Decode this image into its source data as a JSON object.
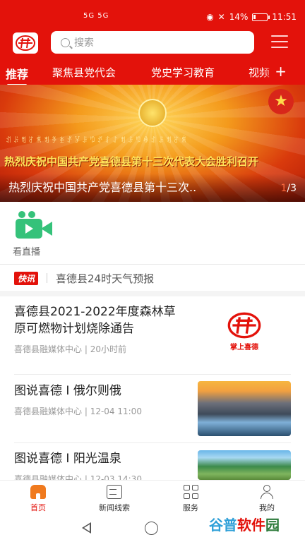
{
  "status_bar": {
    "network_icons": "5G 5G",
    "battery_percent": "14%",
    "time": "11:51"
  },
  "header": {
    "search_placeholder": "搜索",
    "tabs": [
      {
        "label": "推荐",
        "active": true
      },
      {
        "label": "聚焦县党代会",
        "active": false
      },
      {
        "label": "党史学习教育",
        "active": false
      },
      {
        "label": "视频",
        "active": false
      }
    ],
    "add_tab_label": "+"
  },
  "banner": {
    "headline": "热烈庆祝中国共产党喜德县第十三次代表大会胜利召开",
    "caption": "热烈庆祝中国共产党喜德县第十三次..",
    "pager_current": "1",
    "pager_total": "/3"
  },
  "quick_entry": {
    "label": "看直播"
  },
  "flash_news": {
    "badge": "快讯",
    "text": "喜德县24时天气预报"
  },
  "news_list": [
    {
      "title": "喜德县2021-2022年度森林草原可燃物计划烧除通告",
      "source": "喜德县融媒体中心",
      "time": "20小时前",
      "thumb_text": "掌上喜德"
    },
    {
      "title": "图说喜德 I 俄尔则俄",
      "source": "喜德县融媒体中心",
      "time": "12-04 11:00"
    },
    {
      "title": "图说喜德 I 阳光温泉",
      "source": "喜德县融媒体中心",
      "time": "12-03 14:30"
    }
  ],
  "bottom_nav": [
    {
      "label": "首页",
      "active": true
    },
    {
      "label": "新闻线索",
      "active": false
    },
    {
      "label": "服务",
      "active": false
    },
    {
      "label": "我的",
      "active": false
    }
  ],
  "watermark": {
    "part1": "谷普",
    "part2": "软件",
    "part3": "园"
  },
  "colors": {
    "brand_red": "#e3120b",
    "live_green": "#35c27a"
  }
}
